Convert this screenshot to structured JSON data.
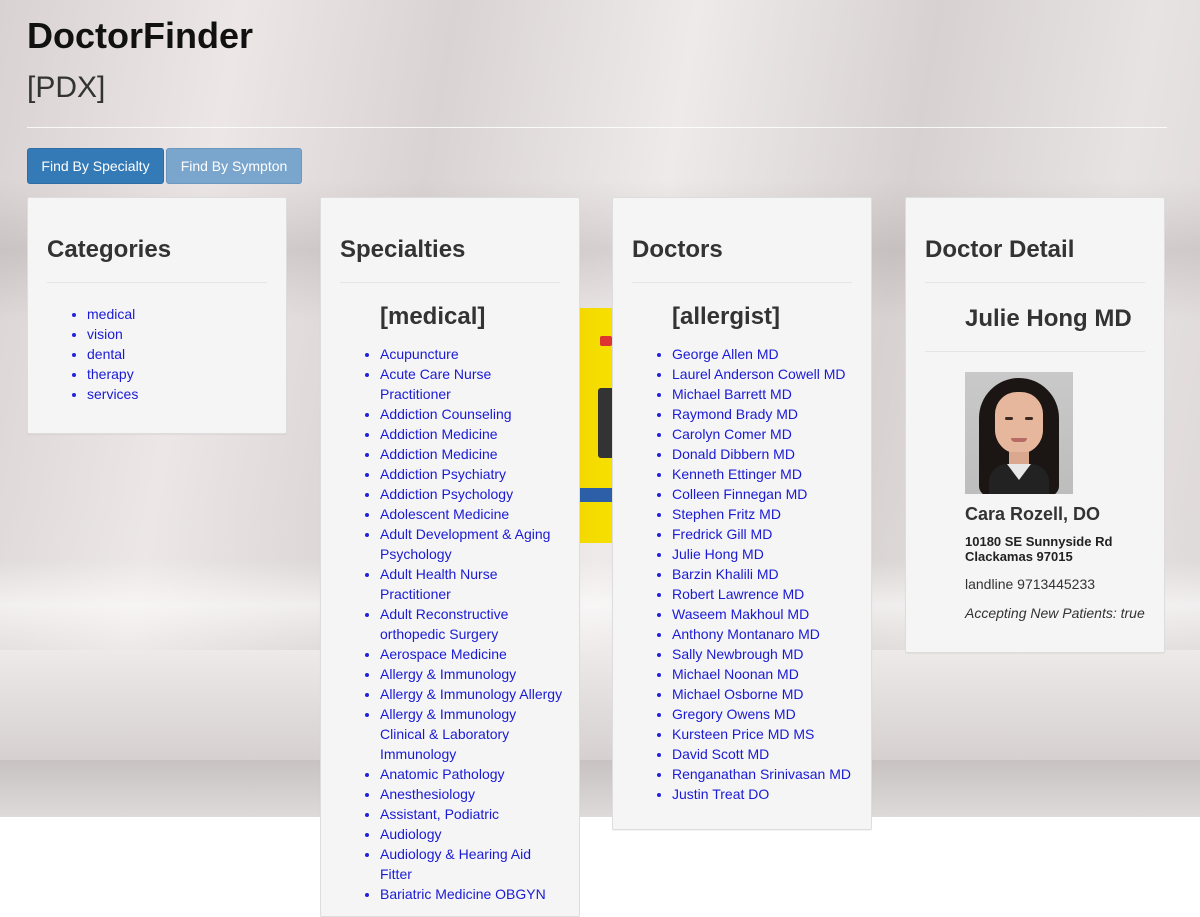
{
  "header": {
    "title": "DoctorFinder",
    "subtitle": "[PDX]"
  },
  "buttons": {
    "specialty": "Find By Specialty",
    "symptom": "Find By Sympton"
  },
  "categories": {
    "heading": "Categories",
    "items": [
      "medical",
      "vision",
      "dental",
      "therapy",
      "services"
    ]
  },
  "specialties": {
    "heading": "Specialties",
    "selected": "[medical]",
    "items": [
      "Acupuncture",
      "Acute Care Nurse Practitioner",
      "Addiction Counseling",
      "Addiction Medicine",
      "Addiction Medicine",
      "Addiction Psychiatry",
      "Addiction Psychology",
      "Adolescent Medicine",
      "Adult Development & Aging Psychology",
      "Adult Health Nurse Practitioner",
      "Adult Reconstructive orthopedic Surgery",
      "Aerospace Medicine",
      "Allergy & Immunology",
      "Allergy & Immunology Allergy",
      "Allergy & Immunology Clinical & Laboratory Immunology",
      "Anatomic Pathology",
      "Anesthesiology",
      "Assistant, Podiatric",
      "Audiology",
      "Audiology & Hearing Aid Fitter",
      "Bariatric Medicine OBGYN"
    ]
  },
  "doctors": {
    "heading": "Doctors",
    "selected": "[allergist]",
    "items": [
      "George Allen MD",
      "Laurel Anderson Cowell MD",
      "Michael Barrett MD",
      "Raymond Brady MD",
      "Carolyn Comer MD",
      "Donald Dibbern MD",
      "Kenneth Ettinger MD",
      "Colleen Finnegan MD",
      "Stephen Fritz MD",
      "Fredrick Gill MD",
      "Julie Hong MD",
      "Barzin Khalili MD",
      "Robert Lawrence MD",
      "Waseem Makhoul MD",
      "Anthony Montanaro MD",
      "Sally Newbrough MD",
      "Michael Noonan MD",
      "Michael Osborne MD",
      "Gregory Owens MD",
      "Kursteen Price MD MS",
      "David Scott MD",
      "Renganathan Srinivasan MD",
      "Justin Treat DO"
    ]
  },
  "detail": {
    "heading": "Doctor Detail",
    "name": "Julie Hong MD",
    "photo_icon": "doctor-portrait",
    "doctor_name": "Cara Rozell, DO",
    "address_line1": "10180 SE Sunnyside Rd",
    "address_line2": "Clackamas 97015",
    "phone": "landline 9713445233",
    "accepting": "Accepting New Patients: true"
  },
  "colors": {
    "primary": "#337ab7",
    "primary_light": "#7aa5cc",
    "link": "#2222dd",
    "panel_bg": "#f5f5f5"
  }
}
